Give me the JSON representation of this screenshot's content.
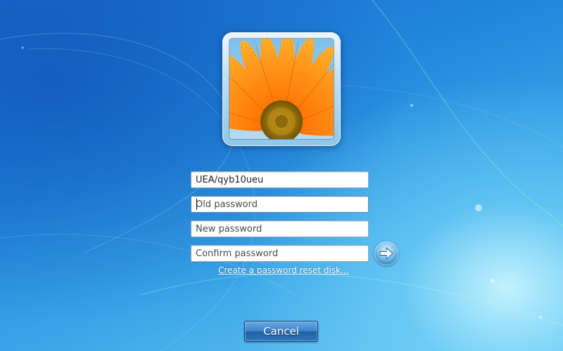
{
  "screen": {
    "name": "Windows 7 change password screen"
  },
  "avatar": {
    "icon": "orange-flower-user-picture"
  },
  "form": {
    "username_value": "UEA/qyb10ueu",
    "old_password_placeholder": "Old password",
    "new_password_placeholder": "New password",
    "confirm_password_placeholder": "Confirm password",
    "submit_icon": "arrow-right-icon"
  },
  "links": {
    "reset_disk": "Create a password reset disk..."
  },
  "buttons": {
    "cancel": "Cancel"
  },
  "colors": {
    "background": "#2186dc",
    "field_background": "#ffffff",
    "link_text": "#ffffff",
    "button_accent": "#3e83cd"
  }
}
